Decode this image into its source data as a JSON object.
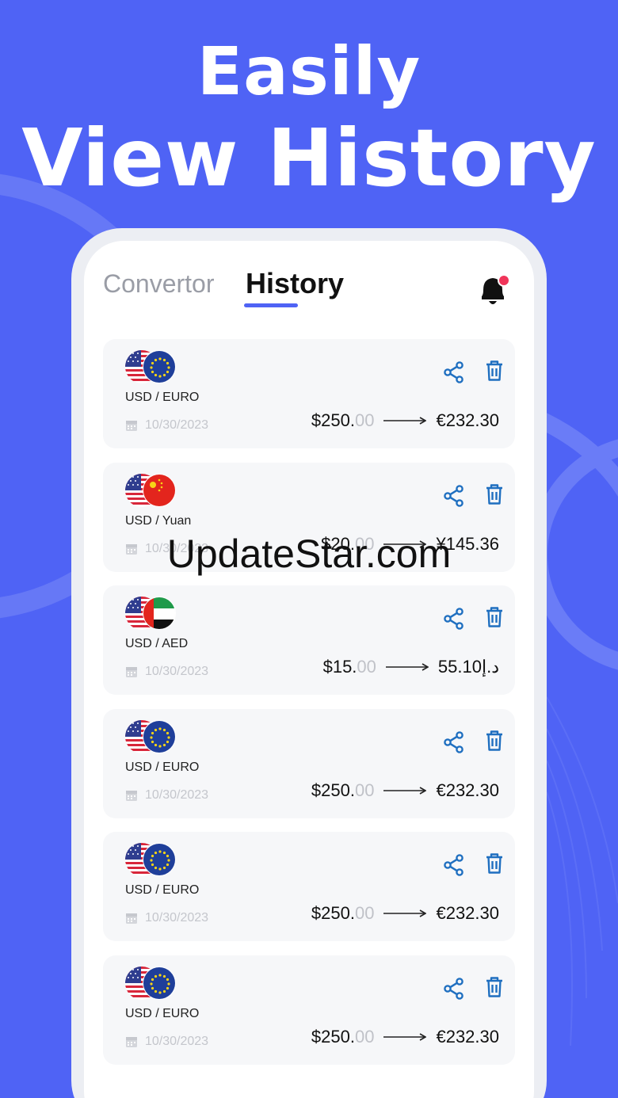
{
  "headline": {
    "line1": "Easily",
    "line2": "View History"
  },
  "tabs": [
    {
      "label": "Convertor",
      "active": false
    },
    {
      "label": "History",
      "active": true
    }
  ],
  "colors": {
    "accent": "#4f63f5",
    "icon_blue": "#1f6fc0",
    "notification_dot": "#f0355a"
  },
  "history": [
    {
      "pair": "USD / EURO",
      "date": "10/30/2023",
      "from_whole": "$250.",
      "from_decimal": "00",
      "to": "€232.30",
      "flags": [
        "us",
        "eu"
      ]
    },
    {
      "pair": "USD / Yuan",
      "date": "10/30/2023",
      "from_whole": "$20.",
      "from_decimal": "00",
      "to": "¥145.36",
      "flags": [
        "us",
        "cn"
      ]
    },
    {
      "pair": "USD / AED",
      "date": "10/30/2023",
      "from_whole": "$15.",
      "from_decimal": "00",
      "to": "55.10د.إ",
      "flags": [
        "us",
        "ae"
      ]
    },
    {
      "pair": "USD / EURO",
      "date": "10/30/2023",
      "from_whole": "$250.",
      "from_decimal": "00",
      "to": "€232.30",
      "flags": [
        "us",
        "eu"
      ]
    },
    {
      "pair": "USD / EURO",
      "date": "10/30/2023",
      "from_whole": "$250.",
      "from_decimal": "00",
      "to": "€232.30",
      "flags": [
        "us",
        "eu"
      ]
    },
    {
      "pair": "USD / EURO",
      "date": "10/30/2023",
      "from_whole": "$250.",
      "from_decimal": "00",
      "to": "€232.30",
      "flags": [
        "us",
        "eu"
      ]
    }
  ],
  "icons": {
    "notification": "bell-icon",
    "share": "share-icon",
    "delete": "trash-icon",
    "date": "calendar-icon"
  },
  "watermark": "UpdateStar.com"
}
